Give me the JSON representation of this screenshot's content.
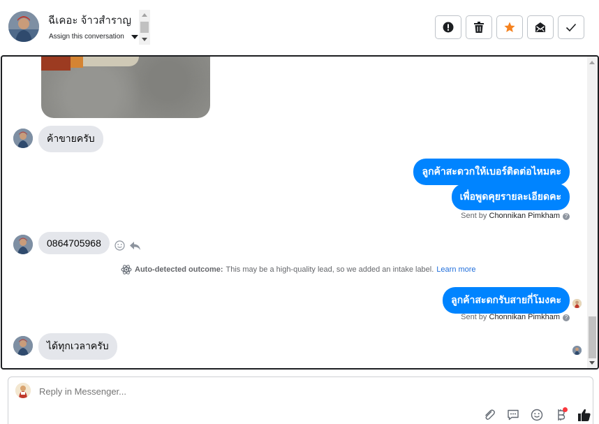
{
  "header": {
    "contact_name": "ฉีเคอะ จ้าวสำราญ",
    "assign_label": "Assign this conversation",
    "actions": [
      {
        "name": "mark-spam-button",
        "icon": "alert-icon"
      },
      {
        "name": "delete-button",
        "icon": "trash-icon"
      },
      {
        "name": "star-button",
        "icon": "star-icon"
      },
      {
        "name": "mark-unread-button",
        "icon": "envelope-icon"
      },
      {
        "name": "mark-done-button",
        "icon": "check-icon"
      }
    ],
    "accent_star": "#f5821f"
  },
  "conversation": {
    "messages": [
      {
        "direction": "in",
        "text": "ค้าขายครับ"
      },
      {
        "direction": "out",
        "text": "ลูกค้าสะดวกให้เบอร์ติดต่อไหมคะ"
      },
      {
        "direction": "out",
        "text": "เพื่อพูดคุยรายละเอียดคะ"
      },
      {
        "direction": "in",
        "text": "0864705968"
      },
      {
        "direction": "out",
        "text": "ลูกค้าสะดกรับสายกี่โมงคะ"
      },
      {
        "direction": "in",
        "text": "ได้ทุกเวลาครับ"
      }
    ],
    "sent_by_prefix": "Sent by",
    "sent_by_1": "Chonnikan Pimkham",
    "sent_by_2": "Chonnikan Pimkham",
    "outcome_label": "Auto-detected outcome:",
    "outcome_text": "This may be a high-quality lead, so we added an intake label.",
    "outcome_link": "Learn more",
    "bubble_out_color": "#0084ff",
    "bubble_in_color": "#e4e6eb"
  },
  "composer": {
    "placeholder": "Reply in Messenger...",
    "tools": [
      "attachment-icon",
      "saved-reply-icon",
      "emoji-icon",
      "baht-payment-icon",
      "like-icon"
    ]
  }
}
